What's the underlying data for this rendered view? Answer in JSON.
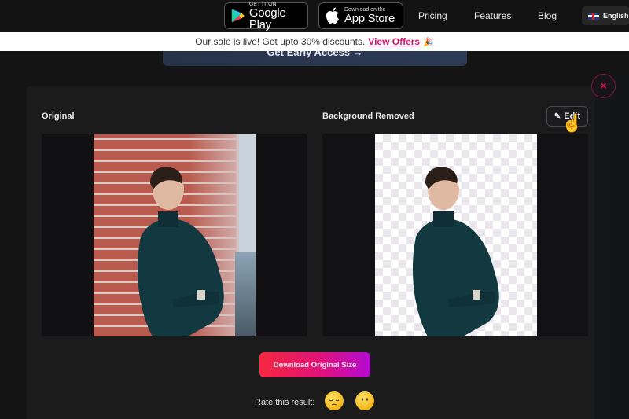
{
  "nav": {
    "google_play": {
      "small": "GET IT ON",
      "big": "Google Play"
    },
    "app_store": {
      "small": "Download on the",
      "big": "App Store"
    },
    "links": [
      "Pricing",
      "Features",
      "Blog"
    ],
    "language": "English"
  },
  "banner": {
    "text": "Our sale is live! Get upto 30% discounts.",
    "link": "View Offers",
    "emoji": "🎉"
  },
  "early_access": {
    "label": "Get Early Access →"
  },
  "modal": {
    "close_label": "×",
    "original_label": "Original",
    "removed_label": "Background Removed",
    "edit_label": "Edit",
    "edit_icon": "✎",
    "download_label": "Download Original Size",
    "rate_label": "Rate this result:",
    "ratings": [
      "😔",
      "😶"
    ]
  },
  "colors": {
    "accent_pink": "#d3146e",
    "gradient_start": "#f6283f",
    "gradient_end": "#b30ad3",
    "close_red": "#d3144f"
  }
}
